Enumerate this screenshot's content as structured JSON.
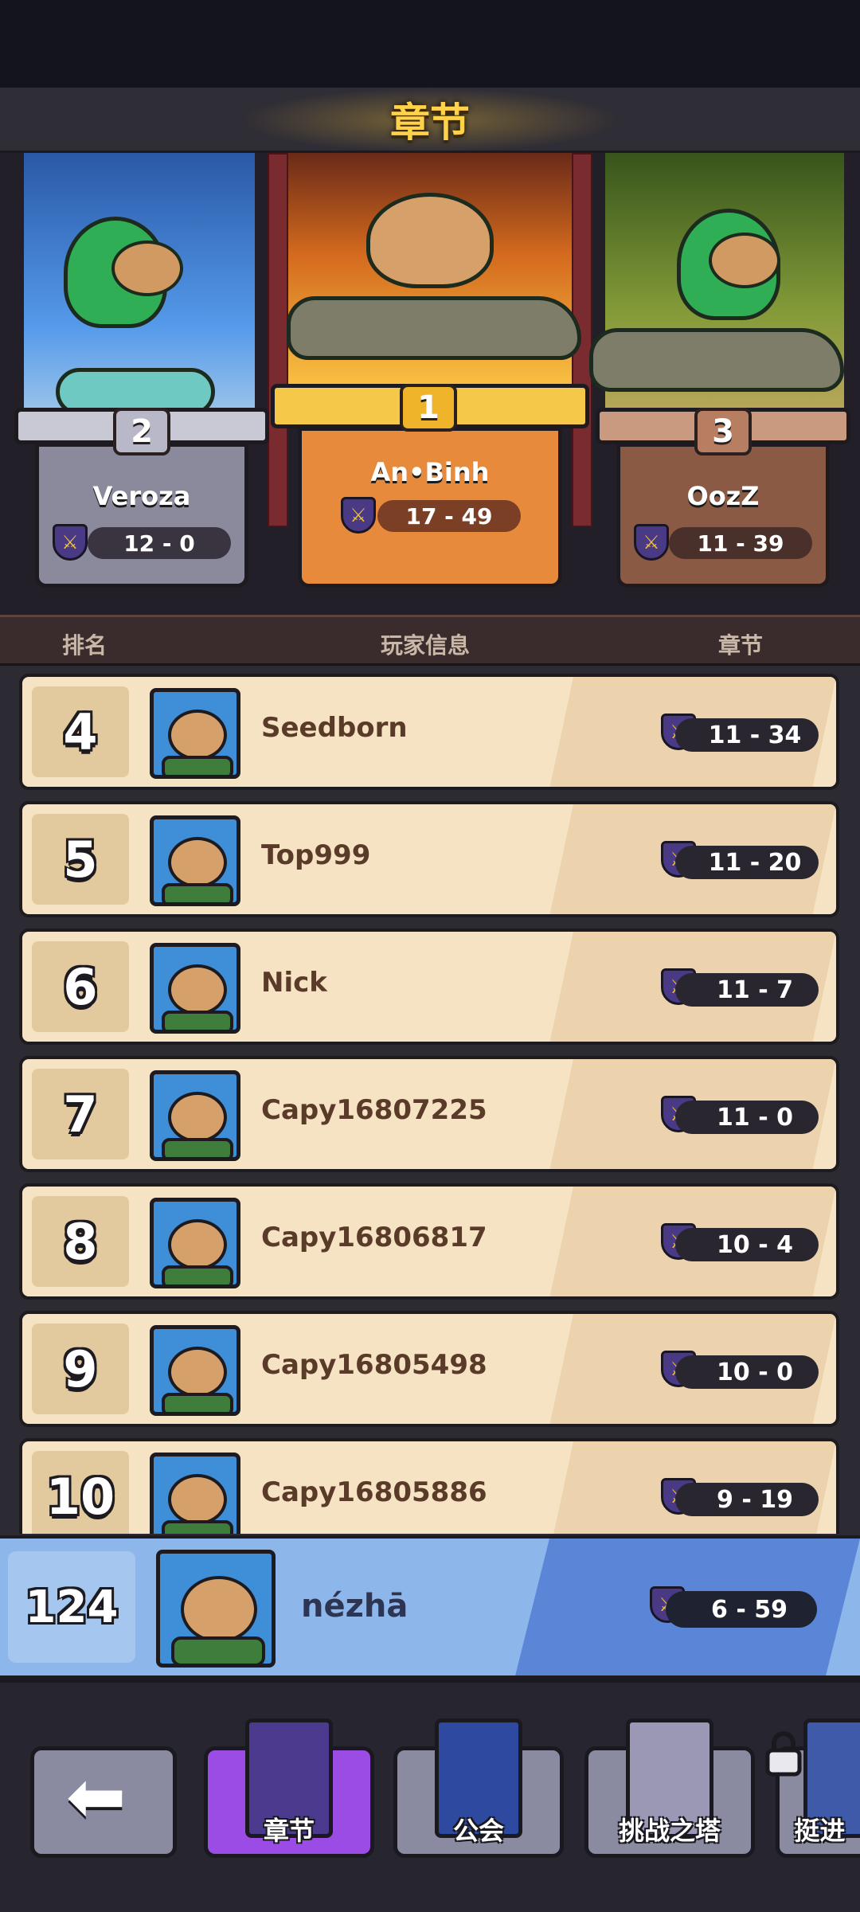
{
  "title": "章节",
  "top3": [
    {
      "rank": "2",
      "name": "Veroza",
      "score": "12 - 0"
    },
    {
      "rank": "1",
      "name": "An•Binh",
      "score": "17 - 49"
    },
    {
      "rank": "3",
      "name": "OozZ",
      "score": "11 - 39"
    }
  ],
  "columns": {
    "rank": "排名",
    "player": "玩家信息",
    "chapter": "章节"
  },
  "rows": [
    {
      "rank": "4",
      "name": "Seedborn",
      "score": "11 - 34"
    },
    {
      "rank": "5",
      "name": "Top999",
      "score": "11 - 20"
    },
    {
      "rank": "6",
      "name": "Nick",
      "score": "11 - 7"
    },
    {
      "rank": "7",
      "name": "Capy16807225",
      "score": "11 - 0"
    },
    {
      "rank": "8",
      "name": "Capy16806817",
      "score": "10 - 4"
    },
    {
      "rank": "9",
      "name": "Capy16805498",
      "score": "10 - 0"
    },
    {
      "rank": "10",
      "name": "Capy16805886",
      "score": "9 - 19"
    }
  ],
  "self": {
    "rank": "124",
    "name": "nézhā",
    "score": "6 - 59"
  },
  "nav": {
    "chapter": "章节",
    "guild": "公会",
    "tower": "挑战之塔",
    "advance": "挺进"
  },
  "colors": {
    "accent_active": "#9b4ce4",
    "title_gold": "#ffd24a",
    "self_row": "#8db6ea"
  }
}
